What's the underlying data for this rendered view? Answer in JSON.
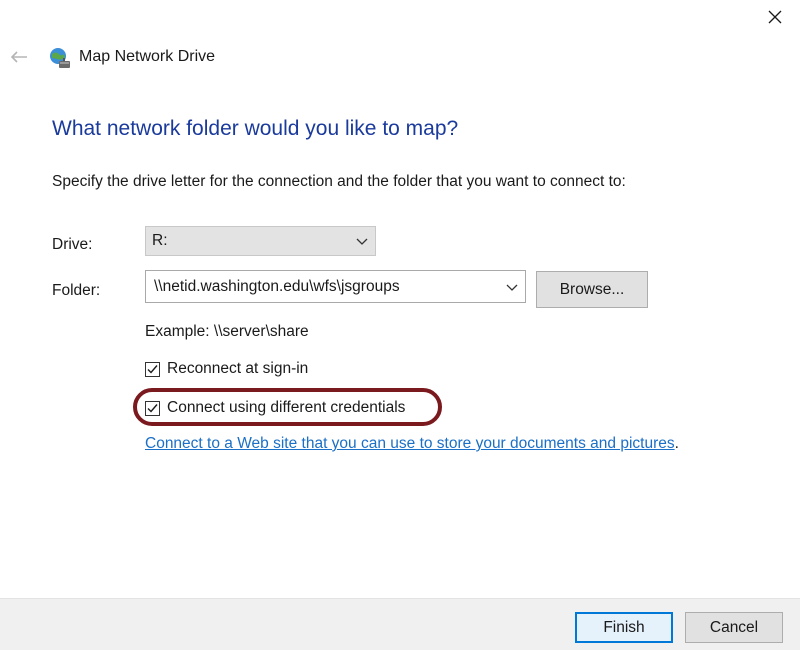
{
  "window": {
    "title": "Map Network Drive",
    "icon": "network-drive-icon",
    "close_icon": "close-icon",
    "back_icon": "back-arrow-icon"
  },
  "heading": "What network folder would you like to map?",
  "instructions": "Specify the drive letter for the connection and the folder that you want to connect to:",
  "drive": {
    "label": "Drive:",
    "value": "R:"
  },
  "folder": {
    "label": "Folder:",
    "value": "\\\\netid.washington.edu\\wfs\\jsgroups",
    "browse_label": "Browse..."
  },
  "example": "Example: \\\\server\\share",
  "reconnect": {
    "label": "Reconnect at sign-in",
    "checked": true
  },
  "credentials": {
    "label": "Connect using different credentials",
    "checked": true
  },
  "web_link": {
    "text": "Connect to a Web site that you can use to store your documents and pictures",
    "suffix": "."
  },
  "footer": {
    "finish_label": "Finish",
    "cancel_label": "Cancel"
  },
  "colors": {
    "heading": "#1a3a9c",
    "link": "#1a6fc6",
    "highlight_ring": "#7a1a1f",
    "default_button_border": "#0078d7"
  }
}
